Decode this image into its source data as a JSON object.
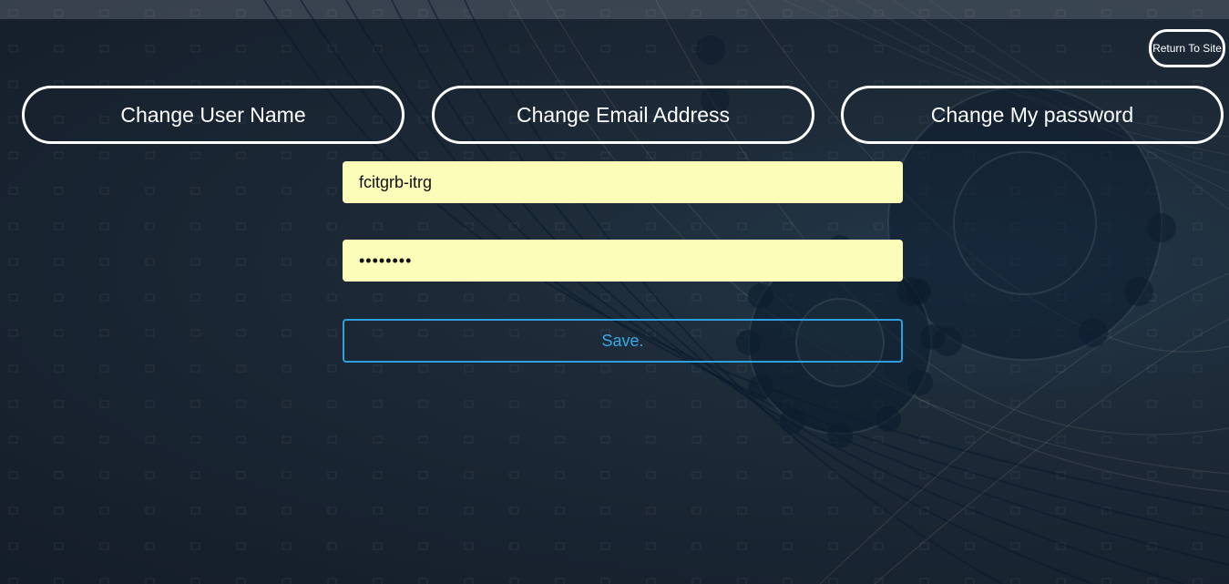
{
  "header": {
    "return_label": "Return To Site"
  },
  "tabs": [
    {
      "label": "Change User Name"
    },
    {
      "label": "Change Email Address"
    },
    {
      "label": "Change My password"
    }
  ],
  "form": {
    "username_value": "fcitgrb-itrg",
    "password_value": "passw0rd",
    "save_label": "Save."
  },
  "colors": {
    "background": "#1d2a37",
    "field_background": "#fcfdb8",
    "save_accent": "#2e9fe0",
    "tab_border": "#ffffff"
  }
}
